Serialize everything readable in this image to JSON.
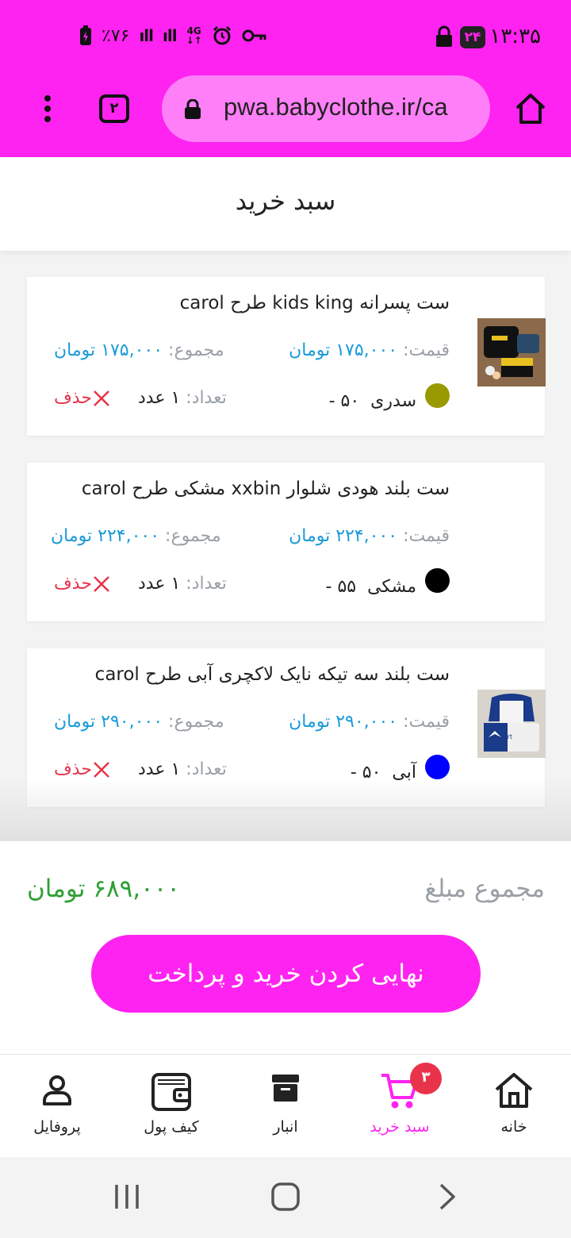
{
  "status_bar": {
    "time": "۱۳:۳۵",
    "notification_badge": "۲۴",
    "battery": "٪۷۶",
    "network_type": "4G"
  },
  "browser": {
    "url": "pwa.babyclothe.ir/ca",
    "tabs_count": "۲"
  },
  "page": {
    "title": "سبد خرید"
  },
  "cart": {
    "price_label": "قیمت:",
    "sum_label": "مجموع:",
    "qty_label": "تعداد:",
    "delete_label": "حذف",
    "items": [
      {
        "title": "ست پسرانه kids king طرح carol",
        "price": "۱۷۵,۰۰۰ تومان",
        "total": "۱۷۵,۰۰۰ تومان",
        "color_name": "سدری",
        "size": "۵۰ -",
        "quantity": "۱ عدد",
        "color_hex": "#999900"
      },
      {
        "title": "ست بلند هودی شلوار xxbin مشکی طرح carol",
        "price": "۲۲۴,۰۰۰ تومان",
        "total": "۲۲۴,۰۰۰ تومان",
        "color_name": "مشکی",
        "size": "۵۵ -",
        "quantity": "۱ عدد",
        "color_hex": "#000000"
      },
      {
        "title": "ست بلند سه تیکه نایک لاکچری آبی طرح carol",
        "price": "۲۹۰,۰۰۰ تومان",
        "total": "۲۹۰,۰۰۰ تومان",
        "color_name": "آبی",
        "size": "۵۰ -",
        "quantity": "۱ عدد",
        "color_hex": "#0000ff"
      }
    ]
  },
  "summary": {
    "label": "مجموع مبلغ",
    "value": "۶۸۹,۰۰۰ تومان",
    "checkout_label": "نهایی کردن خرید و پرداخت"
  },
  "bottom_nav": {
    "home": "خانه",
    "cart": "سبد خرید",
    "cart_badge": "۳",
    "store": "انبار",
    "wallet": "کیف پول",
    "profile": "پروفایل"
  },
  "colors": {
    "accent": "#fe23f0",
    "price_blue": "#1a9ad8",
    "total_green": "#2fa035",
    "delete_red": "#e8334a"
  }
}
